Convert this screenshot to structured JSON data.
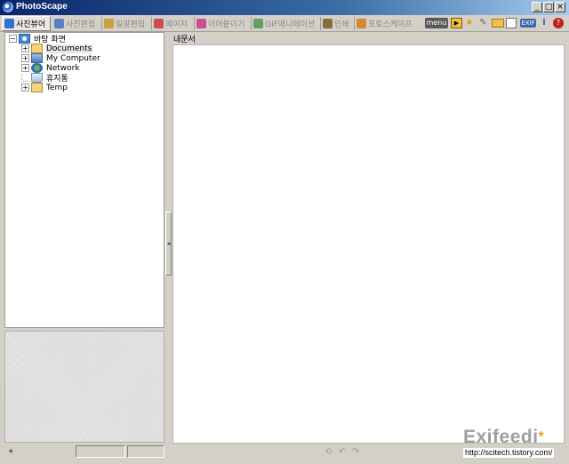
{
  "window": {
    "title": "PhotoScape",
    "minimize": "_",
    "maximize": "□",
    "close": "×"
  },
  "tabs": [
    {
      "label": "사진뷰어",
      "icon": "photo-viewer-icon",
      "color": "#2f6fd6",
      "active": true
    },
    {
      "label": "사진편집",
      "icon": "photo-editor-icon",
      "color": "#5a7fc2",
      "active": false
    },
    {
      "label": "일괄편집",
      "icon": "batch-editor-icon",
      "color": "#c8a040",
      "active": false
    },
    {
      "label": "페이지",
      "icon": "page-icon",
      "color": "#c85050",
      "active": false
    },
    {
      "label": "이어붙이기",
      "icon": "combine-icon",
      "color": "#c85090",
      "active": false
    },
    {
      "label": "GIF애니메이션",
      "icon": "gif-animation-icon",
      "color": "#60a060",
      "active": false
    },
    {
      "label": "인쇄",
      "icon": "print-icon",
      "color": "#8a6a3a",
      "active": false
    },
    {
      "label": "포토스케이프",
      "icon": "photoscape-icon",
      "color": "#d08a30",
      "active": false
    }
  ],
  "toolbar_right": {
    "menu_label": "menu",
    "exif_label": "EXIF",
    "icons": [
      "menu-icon",
      "slideshow-icon",
      "star-icon",
      "tools-icon",
      "folder-icon",
      "copy-icon",
      "exif-icon",
      "info-icon",
      "help-icon"
    ]
  },
  "tree": {
    "root": {
      "label": "바탕 화면",
      "icon": "desktop-icon",
      "expander": "−"
    },
    "children": [
      {
        "label": "Documents",
        "icon": "folder-icon",
        "expander": "+",
        "selected": true
      },
      {
        "label": "My Computer",
        "icon": "computer-icon",
        "expander": "+",
        "selected": false
      },
      {
        "label": "Network",
        "icon": "network-icon",
        "expander": "+",
        "selected": false
      },
      {
        "label": "휴지통",
        "icon": "recycle-bin-icon",
        "expander": "",
        "selected": false
      },
      {
        "label": "Temp",
        "icon": "folder-icon",
        "expander": "+",
        "selected": false
      }
    ]
  },
  "content": {
    "path_label": "내문서"
  },
  "status": {
    "tool_icon": "wand-icon",
    "bottom_icons": [
      "rotate-icon",
      "undo-icon",
      "redo-icon"
    ]
  },
  "watermark": {
    "brand": "Exifeedi",
    "url": "http://scitech.tistory.com/"
  }
}
